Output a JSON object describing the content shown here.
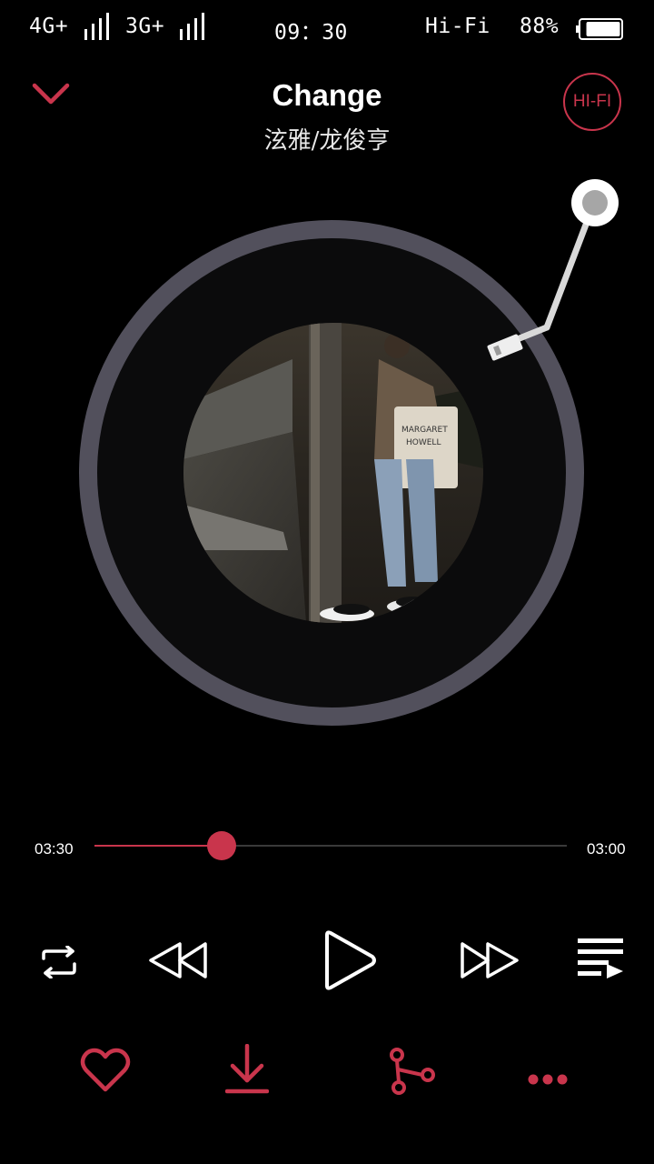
{
  "status_bar": {
    "network1": "4G+",
    "network2": "3G+",
    "time": "09：30",
    "audio_mode": "Hi-Fi",
    "battery": "88%",
    "battery_level": 0.88
  },
  "song": {
    "title": "Change",
    "artist": "泫雅/龙俊亨"
  },
  "header": {
    "hifi_label": "HI-FI"
  },
  "player": {
    "elapsed": "03:30",
    "duration": "03:00",
    "progress": 0.27
  },
  "colors": {
    "accent": "#c9354c",
    "background": "#000000",
    "disc_ring": "#52505c",
    "disc_center": "#0b0b0c",
    "icon_white": "#ffffff"
  },
  "controls": {
    "icons": [
      "repeat-icon",
      "previous-icon",
      "play-icon",
      "next-icon",
      "playlist-icon"
    ]
  },
  "actions": {
    "icons": [
      "heart-icon",
      "download-icon",
      "share-icon",
      "more-icon"
    ]
  }
}
